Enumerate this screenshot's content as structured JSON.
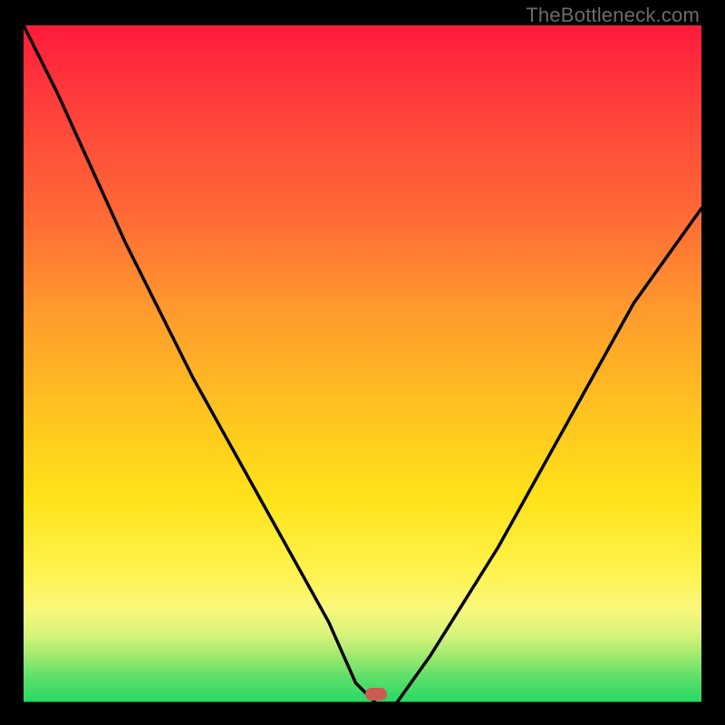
{
  "watermark": "TheBottleneck.com",
  "chart_data": {
    "type": "line",
    "title": "",
    "xlabel": "",
    "ylabel": "",
    "xlim": [
      0,
      1
    ],
    "ylim": [
      0,
      1
    ],
    "grid": false,
    "legend": false,
    "background": "gradient: red→orange→yellow→green (top→bottom)",
    "series": [
      {
        "name": "curve",
        "x": [
          0.0,
          0.05,
          0.1,
          0.15,
          0.2,
          0.25,
          0.3,
          0.35,
          0.4,
          0.45,
          0.49,
          0.52,
          0.55,
          0.6,
          0.65,
          0.7,
          0.75,
          0.8,
          0.85,
          0.9,
          0.95,
          1.0
        ],
        "y": [
          1.0,
          0.9,
          0.79,
          0.68,
          0.58,
          0.48,
          0.39,
          0.3,
          0.21,
          0.12,
          0.03,
          0.0,
          0.0,
          0.07,
          0.15,
          0.23,
          0.32,
          0.41,
          0.5,
          0.59,
          0.66,
          0.73
        ],
        "note": "y is fraction of plot height from bottom; minimum (≈0) between x≈0.49–0.55"
      },
      {
        "name": "baseline",
        "x": [
          0.0,
          1.0
        ],
        "y": [
          0.0,
          0.0
        ]
      }
    ],
    "marker": {
      "x": 0.52,
      "y": 0.01,
      "shape": "rounded-rect",
      "color": "#cf5a54"
    }
  },
  "colors": {
    "frame": "#000000",
    "watermark": "#6b6b6b",
    "curve": "#000000",
    "marker": "#cf5a54"
  }
}
